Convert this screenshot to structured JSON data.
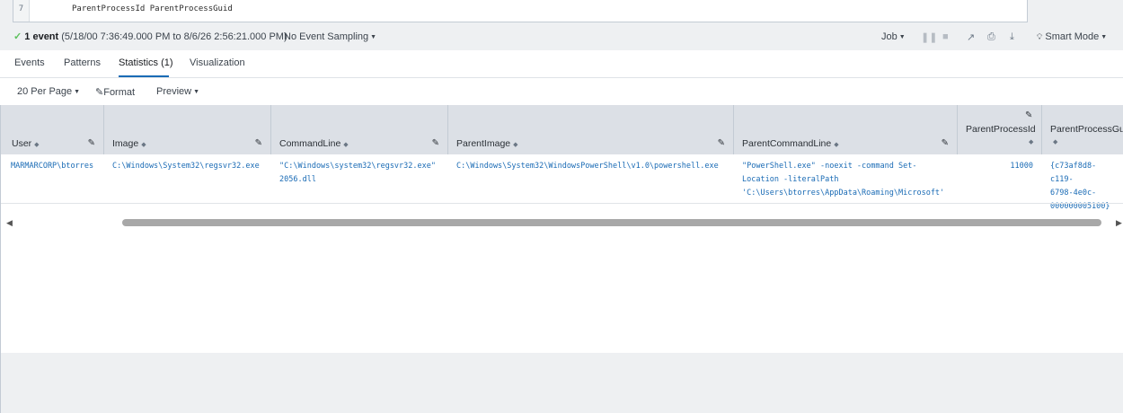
{
  "editor": {
    "line_number": "7",
    "code": "ParentProcessId ParentProcessGuid"
  },
  "status": {
    "check": "✓",
    "event_count": "1 event",
    "time_range": "(5/18/00 7:36:49.000 PM to 8/6/26 2:56:21.000 PM)",
    "sampling": "No Event Sampling",
    "job": "Job",
    "smart_mode": "Smart Mode"
  },
  "tabs": [
    {
      "label": "Events"
    },
    {
      "label": "Patterns"
    },
    {
      "label": "Statistics (1)"
    },
    {
      "label": "Visualization"
    }
  ],
  "toolbar": {
    "per_page": "20 Per Page",
    "format": "Format",
    "preview": "Preview"
  },
  "table": {
    "headers": [
      "User",
      "Image",
      "CommandLine",
      "ParentImage",
      "ParentCommandLine",
      "ParentProcessId",
      "ParentProcessGuid"
    ],
    "row": {
      "user": "MARMARCORP\\btorres",
      "image": "C:\\Windows\\System32\\regsvr32.exe",
      "commandline_1": "\"C:\\Windows\\system32\\regsvr32.exe\"",
      "commandline_2": "2056.dll",
      "parentimage": "C:\\Windows\\System32\\WindowsPowerShell\\v1.0\\powershell.exe",
      "parentcmd_1": "\"PowerShell.exe\" -noexit -command Set-",
      "parentcmd_2": "Location -literalPath",
      "parentcmd_3": "'C:\\Users\\btorres\\AppData\\Roaming\\Microsoft'",
      "parentprocessid": "11000",
      "parentguid_1": "{c73af8d8-c119-",
      "parentguid_2": "6798-4e0c-",
      "parentguid_3": "000000005100}"
    }
  },
  "colors": {
    "accent": "#1a6bb5",
    "success": "#5cc05c",
    "header_bg": "#dce0e6"
  }
}
